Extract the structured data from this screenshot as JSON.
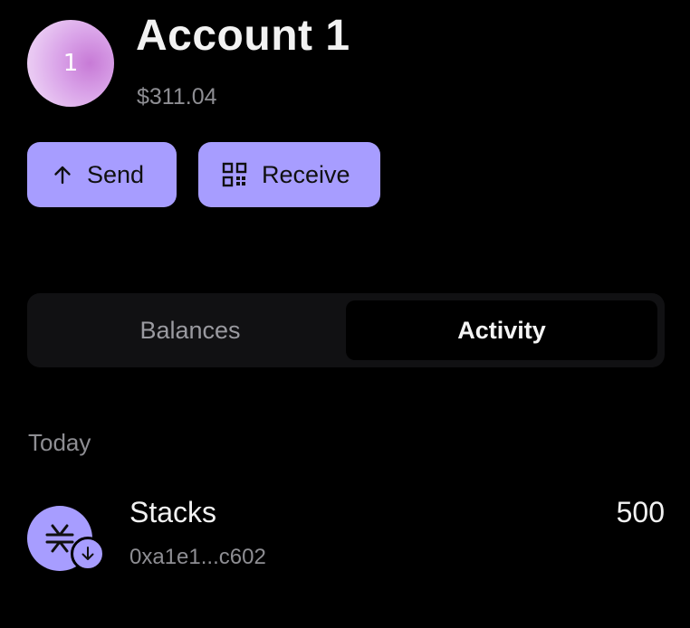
{
  "account": {
    "avatar_text": "1",
    "name": "Account 1",
    "balance": "$311.04"
  },
  "actions": {
    "send_label": "Send",
    "receive_label": "Receive"
  },
  "tabs": [
    {
      "label": "Balances",
      "selected": false
    },
    {
      "label": "Activity",
      "selected": true
    }
  ],
  "activity": {
    "section_title": "Today",
    "items": [
      {
        "token_name": "Stacks",
        "address": "0xa1e1...c602",
        "amount": "500",
        "icon": "stacks-icon",
        "badge_icon": "arrow-down-icon"
      }
    ]
  },
  "colors": {
    "background": "#000000",
    "accent": "#a79dff",
    "muted_text": "#8e8e93",
    "tab_track": "#111113"
  }
}
